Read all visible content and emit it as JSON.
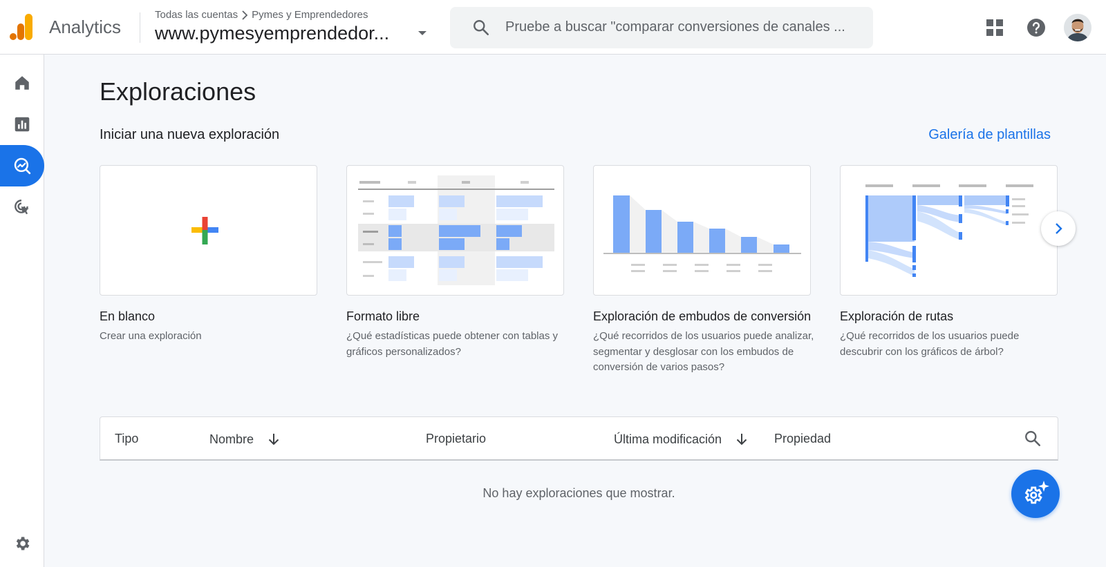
{
  "app": {
    "brand": "Analytics"
  },
  "header": {
    "breadcrumb_account": "Todas las cuentas",
    "breadcrumb_property": "Pymes y Emprendedores",
    "property_name": "www.pymesyemprendedor...",
    "search_placeholder": "Pruebe a buscar \"comparar conversiones de canales ..."
  },
  "sidebar": {
    "items": [
      {
        "icon": "home-icon"
      },
      {
        "icon": "reports-icon"
      },
      {
        "icon": "explore-icon",
        "active": true
      },
      {
        "icon": "advertising-icon"
      }
    ],
    "settings_icon": "gear-icon"
  },
  "page": {
    "title": "Exploraciones",
    "section_title": "Iniciar una nueva exploración",
    "gallery_link": "Galería de plantillas"
  },
  "templates": [
    {
      "title": "En blanco",
      "description": "Crear una exploración"
    },
    {
      "title": "Formato libre",
      "description": "¿Qué estadísticas puede obtener con tablas y gráficos personalizados?"
    },
    {
      "title": "Exploración de embudos de conversión",
      "description": "¿Qué recorridos de los usuarios puede analizar, segmentar y desglosar con los embudos de conversión de varios pasos?"
    },
    {
      "title": "Exploración de rutas",
      "description": "¿Qué recorridos de los usuarios puede descubrir con los gráficos de árbol?"
    }
  ],
  "table": {
    "columns": [
      "Tipo",
      "Nombre",
      "Propietario",
      "Última modificación",
      "Propiedad"
    ],
    "empty_message": "No hay exploraciones que mostrar."
  },
  "colors": {
    "accent": "#1a73e8",
    "logo_orange": "#f9ab00",
    "logo_dark_orange": "#e37400"
  }
}
